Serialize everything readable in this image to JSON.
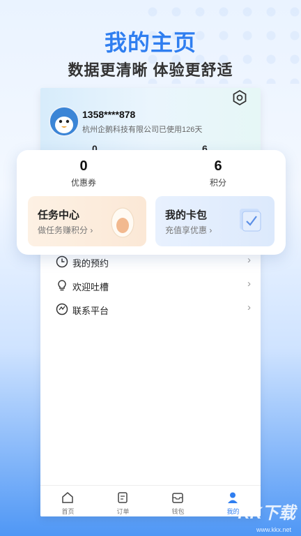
{
  "promo": {
    "headline": "我的主页",
    "subline": "数据更清晰 体验更舒适"
  },
  "profile": {
    "phone": "1358****878",
    "company_line": "杭州企鹅科技有限公司已使用126天"
  },
  "stats": [
    {
      "value": "0",
      "label": "优惠券"
    },
    {
      "value": "6",
      "label": "积分"
    }
  ],
  "tiles": {
    "task": {
      "title": "任务中心",
      "subtitle": "做任务赚积分 ›"
    },
    "wallet": {
      "title": "我的卡包",
      "subtitle": "充值享优惠 ›"
    }
  },
  "menu": [
    {
      "label": "我的预约",
      "icon": "clock-icon"
    },
    {
      "label": "欢迎吐槽",
      "icon": "lightbulb-icon"
    },
    {
      "label": "联系平台",
      "icon": "headset-icon"
    }
  ],
  "tabs": [
    {
      "label": "首页",
      "icon": "home-icon"
    },
    {
      "label": "订单",
      "icon": "order-icon"
    },
    {
      "label": "钱包",
      "icon": "wallet-icon"
    },
    {
      "label": "我的",
      "icon": "user-icon",
      "active": true
    }
  ],
  "watermark": {
    "brand": "KK下载",
    "url": "www.kkx.net"
  },
  "colors": {
    "accent": "#2f7ef0",
    "active_tab": "#2f7ef0"
  }
}
